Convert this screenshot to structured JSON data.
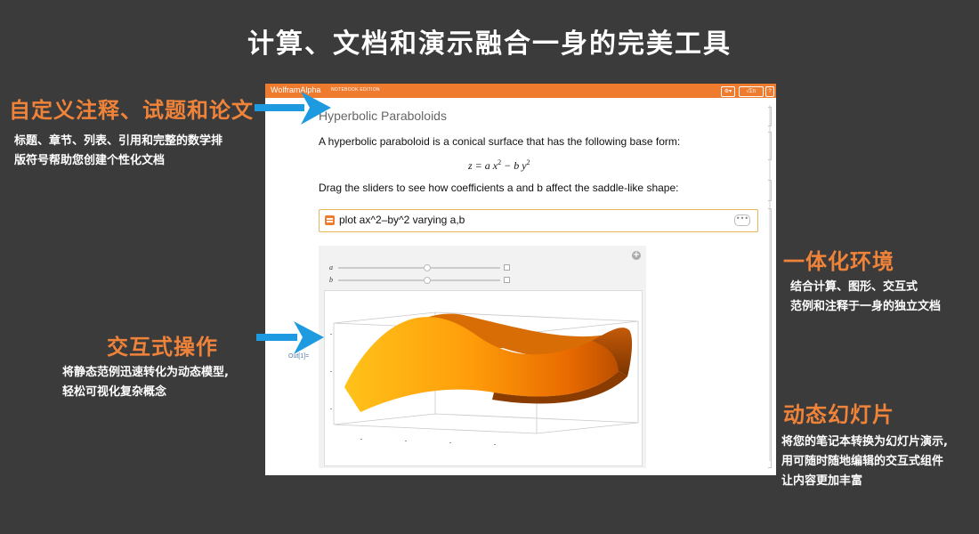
{
  "headline": "计算、文档和演示融合一身的完美工具",
  "features": {
    "docs": {
      "title": "自定义注释、试题和论文",
      "desc_line1": "标题、章节、列表、引用和完整的数学排",
      "desc_line2": "版符号帮助您创建个性化文档"
    },
    "env": {
      "title": "一体化环境",
      "desc_line1": "结合计算、图形、交互式",
      "desc_line2": "范例和注释于一身的独立文档"
    },
    "interact": {
      "title": "交互式操作",
      "desc_line1": "将静态范例迅速转化为动态模型,",
      "desc_line2": "轻松可视化复杂概念"
    },
    "slides": {
      "title": "动态幻灯片",
      "desc_line1": "将您的笔记本转换为幻灯片演示,",
      "desc_line2": "用可随时随地编辑的交互式组件",
      "desc_line3": "让内容更加丰富"
    }
  },
  "notebook": {
    "brand": "WolframAlpha",
    "edition": "NOTEBOOK EDITION",
    "title": "Hyperbolic Paraboloids",
    "intro": "A hyperbolic paraboloid is a conical surface that has the following base form:",
    "formula_main": "z = a x",
    "formula_mid": " − b y",
    "formula_exp": "2",
    "instruction": "Drag the sliders to see how coefficients a and b affect the saddle-like shape:",
    "input_query": "plot ax^2–by^2 varying a,b",
    "more": "•••",
    "slider_a": "a",
    "slider_b": "b",
    "slider_a_value": 0.55,
    "slider_b_value": 0.55,
    "out_label": "Out[1]=",
    "toolbar_gear": "⚙▾",
    "toolbar_math": "√Σπ",
    "toolbar_help": "?"
  },
  "colors": {
    "accent": "#f0833a",
    "arrow": "#1e9be0",
    "titlebar": "#ef7b2f"
  }
}
